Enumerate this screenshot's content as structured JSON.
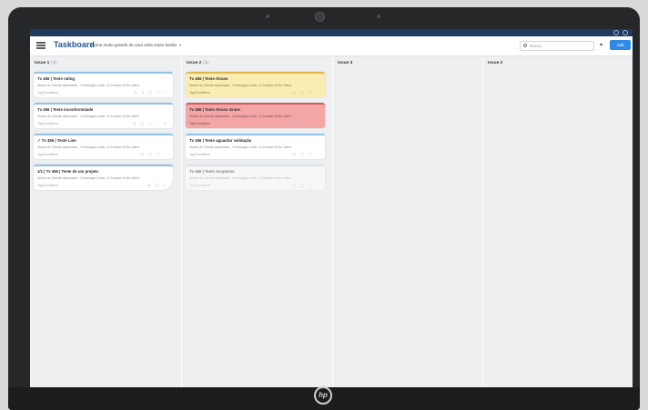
{
  "app": {
    "brand": "Taskboard",
    "board_name": "Nome muito grande de uma vista muito bonita",
    "search_placeholder": "Buscar",
    "add_label": "Add"
  },
  "columns": [
    {
      "title": "Issue 1",
      "count": "(4)",
      "cards": [
        {
          "title": "Tv 456 | Teste rating",
          "desc": "Nome do Cliente associado - Certosagon Ltda - A Contact of the client",
          "foot": "Tag Excellence",
          "icons": "◷ 4 ▢ ☆ ◔",
          "color": ""
        },
        {
          "title": "Tv 456 | Teste inconformidade",
          "desc": "Nome do Cliente associado - Certosagon Ltda - A Contact of the client",
          "foot": "Tag Excellence",
          "icons": "◷ ▢ ☆ ◔ ⚠",
          "color": ""
        },
        {
          "title": "✓ Tv 456 | Teste Line",
          "desc": "Nome do Cliente associado - Certosagon Ltda - A Contact of the client",
          "foot": "Tag Excellence",
          "icons": "◷ ▢ ☆ ◔",
          "color": ""
        },
        {
          "title": "1/1 | Tv 456 | Teste de um projeto",
          "desc": "Nome do Cliente associado - Certosagon Ltda - A Contact of the client",
          "foot": "Tag Excellence",
          "icons": "◷ ▢ ☆",
          "color": ""
        }
      ]
    },
    {
      "title": "Issue 2",
      "count": "(4)",
      "cards": [
        {
          "title": "Tv 456 | Teste Atraso",
          "desc": "Nome do Cliente associado - Certosagon Ltda - A Contact of the client",
          "foot": "Tag Excellence",
          "icons": "◷ ▢ ☆ ◔",
          "color": "yellow"
        },
        {
          "title": "Tv 456 | Teste Atraso Grave",
          "desc": "Nome do Cliente associado - Certosagon Ltda - A Contact of the client",
          "foot": "Tag Excellence",
          "icons": "◷ ▢ ☆ ◔",
          "color": "red"
        },
        {
          "title": "Tv 456 | Teste aguardar validação",
          "desc": "Nome do Cliente associado - Certosagon Ltda - A Contact of the client",
          "foot": "Tag Excellence",
          "icons": "◷ ▢ ☆ ◔",
          "color": ""
        },
        {
          "title": "Tv 456 | Teste Suspenso",
          "desc": "Nome do Cliente associado - Certosagon Ltda - A Contact of the client",
          "foot": "Tag Excellence",
          "icons": "◷ ▢ ☆ ◔",
          "color": "faded"
        }
      ]
    },
    {
      "title": "Issue 3",
      "count": "",
      "cards": []
    },
    {
      "title": "Issue 2",
      "count": "",
      "cards": []
    }
  ],
  "colors": {
    "accent": "#2e8ae6",
    "brand": "#23598c",
    "warning": "#fbecb2",
    "danger": "#f4a6a6"
  }
}
